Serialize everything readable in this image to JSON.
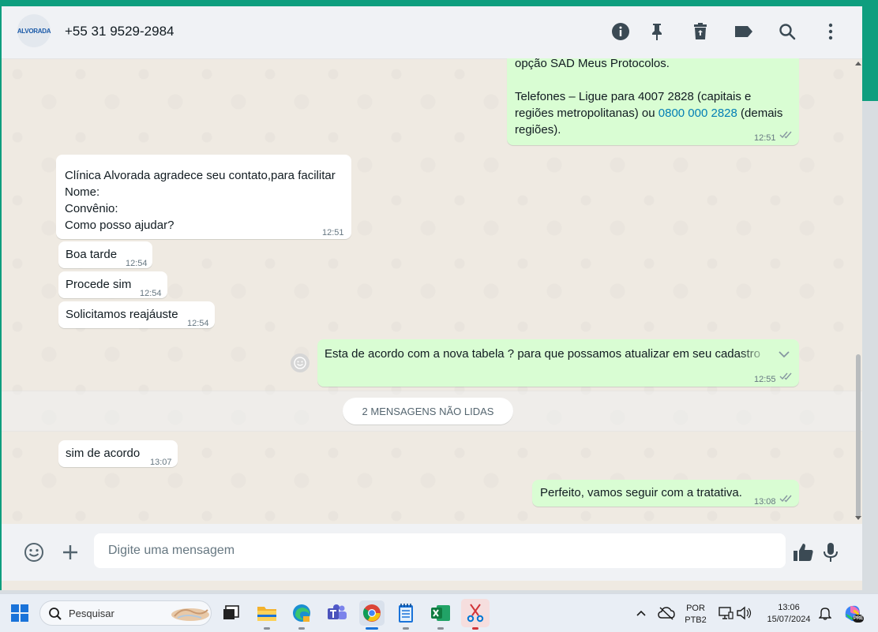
{
  "header": {
    "avatar_text": "ALVORADA",
    "contact": "+55 31 9529-2984",
    "icons": [
      "info-icon",
      "pin-icon",
      "delete-icon",
      "label-icon",
      "search-icon",
      "menu-icon"
    ]
  },
  "messages": {
    "m1": {
      "line1": "opção SAD Meus Protocolos.",
      "line2": "Telefones – Ligue para 4007 2828 (capitais e",
      "line3a": "regiões metropolitanas) ou ",
      "link": "0800 000 2828",
      "line3b": " (demais",
      "line4": "regiões).",
      "time": "12:51"
    },
    "m2": {
      "line1": "Clínica Alvorada agradece seu contato,para facilitar",
      "line2": "Nome:",
      "line3": "Convênio:",
      "line4": "Como posso ajudar?",
      "time": "12:51"
    },
    "m3": {
      "text": "Boa tarde",
      "time": "12:54"
    },
    "m4": {
      "text": "Procede sim",
      "time": "12:54"
    },
    "m5": {
      "text": "Solicitamos reajáuste",
      "time": "12:54"
    },
    "m6": {
      "text": "Esta de acordo com a nova tabela ?  para que possamos atualizar em seu cadastro",
      "time": "12:55"
    },
    "m7": {
      "text": "sim de acordo",
      "time": "13:07"
    },
    "m8": {
      "text": "Perfeito, vamos seguir com a tratativa.",
      "time": "13:08"
    }
  },
  "unread_banner": "2 MENSAGENS NÃO LIDAS",
  "composer": {
    "placeholder": "Digite uma mensagem"
  },
  "taskbar": {
    "search_label": "Pesquisar",
    "lang_top": "POR",
    "lang_bottom": "PTB2",
    "time": "13:06",
    "date": "15/07/2024",
    "copilot_badge": "PRE"
  },
  "colors": {
    "accent": "#0e9e7e",
    "outgoing": "#d9fdd3",
    "incoming": "#ffffff",
    "link": "#027eb5"
  }
}
